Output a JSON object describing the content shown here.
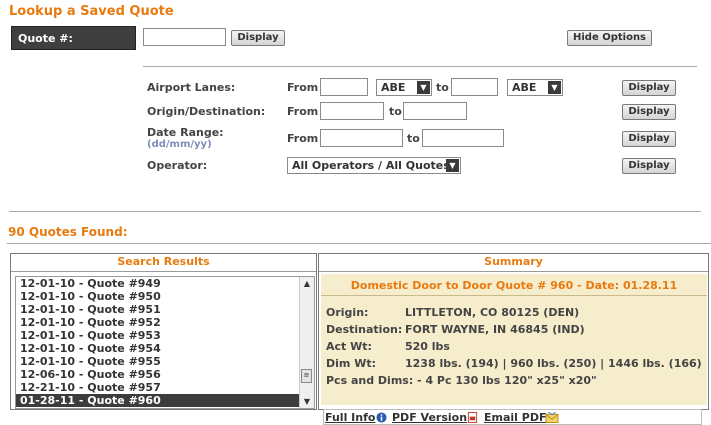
{
  "title": "Lookup a Saved Quote",
  "quote": {
    "label": "Quote #:",
    "value": "",
    "display_label": "Display"
  },
  "hide_options_label": "Hide Options",
  "options": {
    "airport": {
      "label": "Airport Lanes:",
      "from_label": "From",
      "to_label": "to",
      "from_select": "ABE",
      "to_select": "ABE",
      "display_label": "Display"
    },
    "origin": {
      "label": "Origin/Destination:",
      "from_label": "From",
      "to_label": "to",
      "display_label": "Display"
    },
    "date": {
      "label": "Date Range:",
      "sublabel": "(dd/mm/yy)",
      "from_label": "From",
      "to_label": "to",
      "display_label": "Display"
    },
    "operator": {
      "label": "Operator:",
      "select": "All Operators / All Quotes",
      "display_label": "Display"
    }
  },
  "results_count": "90 Quotes Found:",
  "search_results": {
    "header": "Search Results",
    "items": [
      "12-01-10 - Quote #949",
      "12-01-10 - Quote #950",
      "12-01-10 - Quote #951",
      "12-01-10 - Quote #952",
      "12-01-10 - Quote #953",
      "12-01-10 - Quote #954",
      "12-01-10 - Quote #955",
      "12-06-10 - Quote #956",
      "12-21-10 - Quote #957",
      "01-28-11 - Quote #960"
    ],
    "selected_index": 9
  },
  "summary": {
    "header": "Summary",
    "title": "Domestic Door to Door Quote # 960 - Date: 01.28.11",
    "origin_label": "Origin:",
    "origin": "LITTLETON, CO 80125 (DEN)",
    "dest_label": "Destination:",
    "dest": "FORT WAYNE, IN 46845 (IND)",
    "actwt_label": "Act Wt:",
    "actwt": "520 lbs",
    "dimwt_label": "Dim Wt:",
    "dimwt": "1238 lbs. (194) | 960 lbs. (250) | 1446 lbs. (166)",
    "pcs": "Pcs and Dims: - 4 Pc 130 lbs 120\" x25\" x20\"",
    "links": {
      "full_info": "Full Info",
      "pdf_version": "PDF Version",
      "email_pdf": "Email PDF"
    }
  },
  "colors": {
    "accent": "#e87a10",
    "summary_bg": "#f6edcc",
    "dark_box": "#3f3f3f"
  }
}
